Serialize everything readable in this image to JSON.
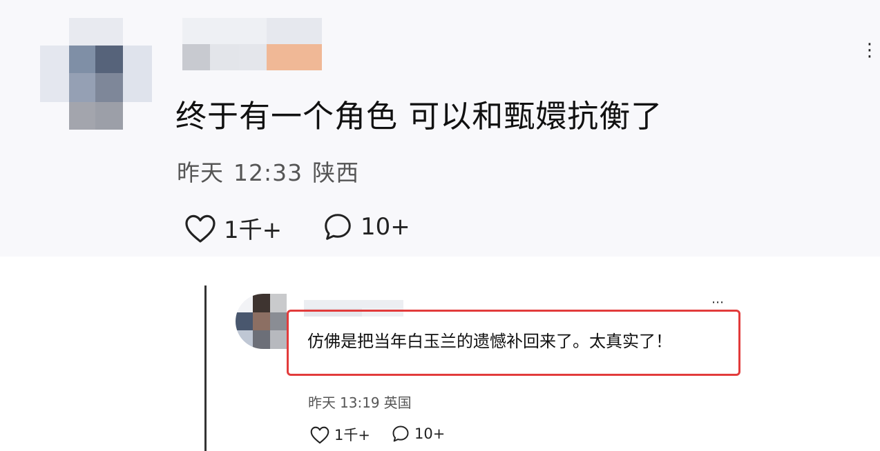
{
  "post": {
    "text": "终于有一个角色 可以和甄嬛抗衡了",
    "meta": {
      "date": "昨天",
      "time": "12:33",
      "location": "陕西"
    },
    "likes": "1千+",
    "comments": "10+"
  },
  "reply": {
    "text": "仿佛是把当年白玉兰的遗憾补回来了。太真实了！",
    "meta": {
      "date": "昨天",
      "time": "13:19",
      "location": "英国"
    },
    "likes": "1千+",
    "comments": "10+"
  },
  "icons": {
    "more": "more-options-icon",
    "like": "heart-outline-icon",
    "comment": "speech-bubble-icon"
  },
  "colors": {
    "highlight_box": "#e23b3b",
    "text": "#111111",
    "meta_text": "#555555"
  }
}
